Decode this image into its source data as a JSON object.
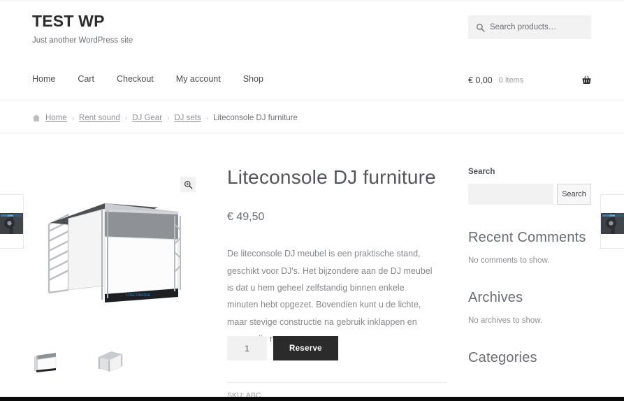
{
  "site": {
    "title": "TEST WP",
    "tagline": "Just another WordPress site"
  },
  "header_search": {
    "placeholder": "Search products…",
    "value": "",
    "icon": "search-icon"
  },
  "nav": {
    "items": [
      {
        "label": "Home"
      },
      {
        "label": "Cart"
      },
      {
        "label": "Checkout"
      },
      {
        "label": "My account"
      },
      {
        "label": "Shop"
      }
    ]
  },
  "cart": {
    "amount": "€ 0,00",
    "count": "0 items",
    "icon": "shopping-basket-icon"
  },
  "breadcrumb": {
    "home_icon": "home-icon",
    "separator": "›",
    "items": [
      {
        "label": "Home",
        "link": true
      },
      {
        "label": "Rent sound",
        "link": true
      },
      {
        "label": "DJ Gear",
        "link": true
      },
      {
        "label": "DJ sets",
        "link": true
      },
      {
        "label": "Liteconsole DJ furniture",
        "link": false
      }
    ]
  },
  "gallery": {
    "zoom_icon": "magnifier-plus-icon",
    "main_image_alt": "Liteconsole DJ furniture white truss booth",
    "thumbnails": [
      {
        "alt": "Liteconsole DJ furniture front view"
      },
      {
        "alt": "Liteconsole DJ furniture angled view"
      }
    ]
  },
  "edge_cards": [
    {
      "position": "left",
      "alt": "DJ CD player product thumbnail"
    },
    {
      "position": "right",
      "alt": "DJ CD player product thumbnail"
    }
  ],
  "product": {
    "title": "Liteconsole DJ furniture",
    "price": "€ 49,50",
    "description": "De liteconsole DJ meubel is een praktische stand, geschikt voor DJ's. Het bijzondere aan de DJ meubel is dat u hem geheel zelfstandig binnen enkele minuten hebt opgezet. Bovendien kunt u de lichte, maar stevige constructie na gebruik inklappen en eenvoudig meenemen.",
    "quantity": "1",
    "add_to_cart_label": "Reserve",
    "sku": "SKU: ABC"
  },
  "sidebar": {
    "search": {
      "title": "Search",
      "value": "",
      "placeholder": "",
      "button_label": "Search"
    },
    "widgets": [
      {
        "title": "Recent Comments",
        "empty": "No comments to show."
      },
      {
        "title": "Archives",
        "empty": "No archives to show."
      },
      {
        "title": "Categories",
        "empty": ""
      }
    ]
  },
  "colors": {
    "button_dark": "#2b2b2b",
    "text_muted": "#8d9095",
    "field_bg": "#f2f2f2"
  }
}
